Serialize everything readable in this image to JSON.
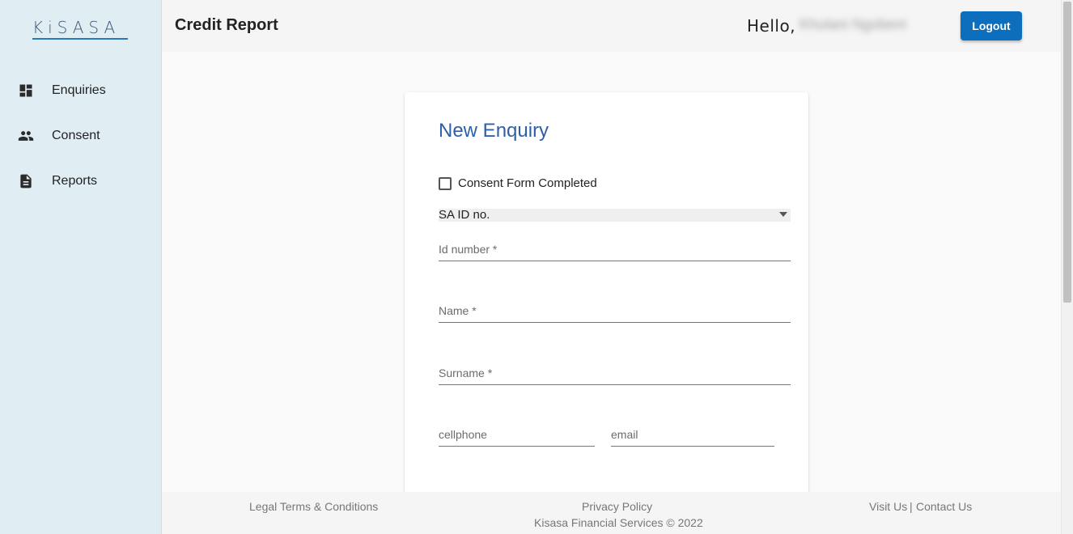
{
  "app": {
    "logo_text": "KiSASA",
    "brand_colors": {
      "sidebar_bg": "#e0eef4",
      "accent": "#0d6ebd",
      "title_blue": "#2f5fa8"
    }
  },
  "sidebar": {
    "items": [
      {
        "label": "Enquiries",
        "icon": "dashboard-icon"
      },
      {
        "label": "Consent",
        "icon": "people-icon"
      },
      {
        "label": "Reports",
        "icon": "document-icon"
      }
    ]
  },
  "header": {
    "title": "Credit Report",
    "greeting": "Hello,",
    "user_name": "Khulani Ngobeni",
    "logout_label": "Logout"
  },
  "form": {
    "title": "New Enquiry",
    "consent_checkbox_label": "Consent Form Completed",
    "consent_checked": false,
    "id_type_selected": "SA ID no.",
    "id_number_placeholder": "Id number *",
    "name_placeholder": "Name *",
    "surname_placeholder": "Surname *",
    "cellphone_placeholder": "cellphone",
    "email_placeholder": "email"
  },
  "footer": {
    "legal_link": "Legal Terms & Conditions",
    "privacy_link": "Privacy Policy",
    "visit_link": "Visit Us",
    "separator": "|",
    "contact_link": "Contact Us",
    "copyright": "Kisasa Financial Services © 2022"
  }
}
